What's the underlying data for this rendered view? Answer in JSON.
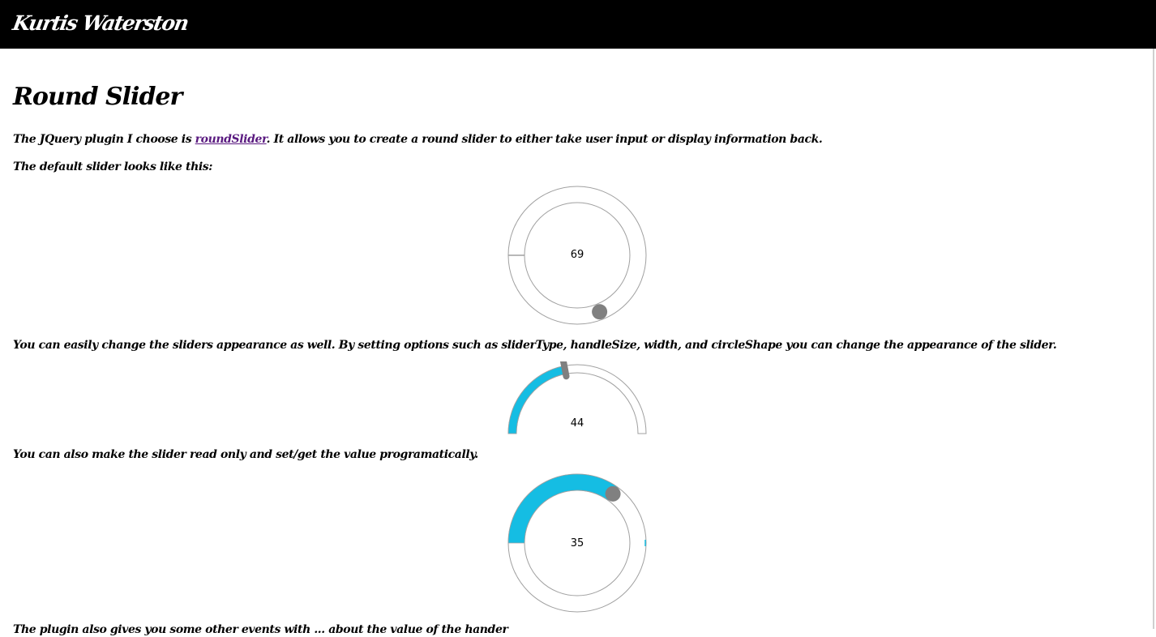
{
  "header": {
    "brand": "Kurtis Waterston"
  },
  "page": {
    "title": "Round Slider",
    "intro_before": "The JQuery plugin I choose is ",
    "intro_link": "roundSlider",
    "intro_after": ". It allows you to create a round slider to either take user input or display information back.",
    "default_text": "The default slider looks like this:",
    "appearance_text": "You can easily change the sliders appearance as well. By setting options such as sliderType, handleSize, width, and circleShape you can change the appearance of the slider.",
    "readonly_text": "You can also make the slider read only and set/get the value programatically.",
    "bottom_text": "The plugin also gives you some other events with ... about the value of the hander"
  },
  "sliders": [
    {
      "value": "69",
      "type": "default",
      "circle_shape": "full",
      "fill": 0,
      "handle": 0.69
    },
    {
      "value": "44",
      "type": "range-min",
      "circle_shape": "half-top",
      "fill": 0.44,
      "handle": 0.44
    },
    {
      "value": "35",
      "type": "range-min",
      "circle_shape": "full",
      "fill": 0.35,
      "handle": 0.35,
      "read_only": true
    }
  ],
  "colors": {
    "header_bg": "#000000",
    "range_fill": "#15bde3",
    "track": "#ffffff",
    "track_border": "#a0a0a0",
    "handle": "#808080",
    "link": "#5a1a80"
  }
}
